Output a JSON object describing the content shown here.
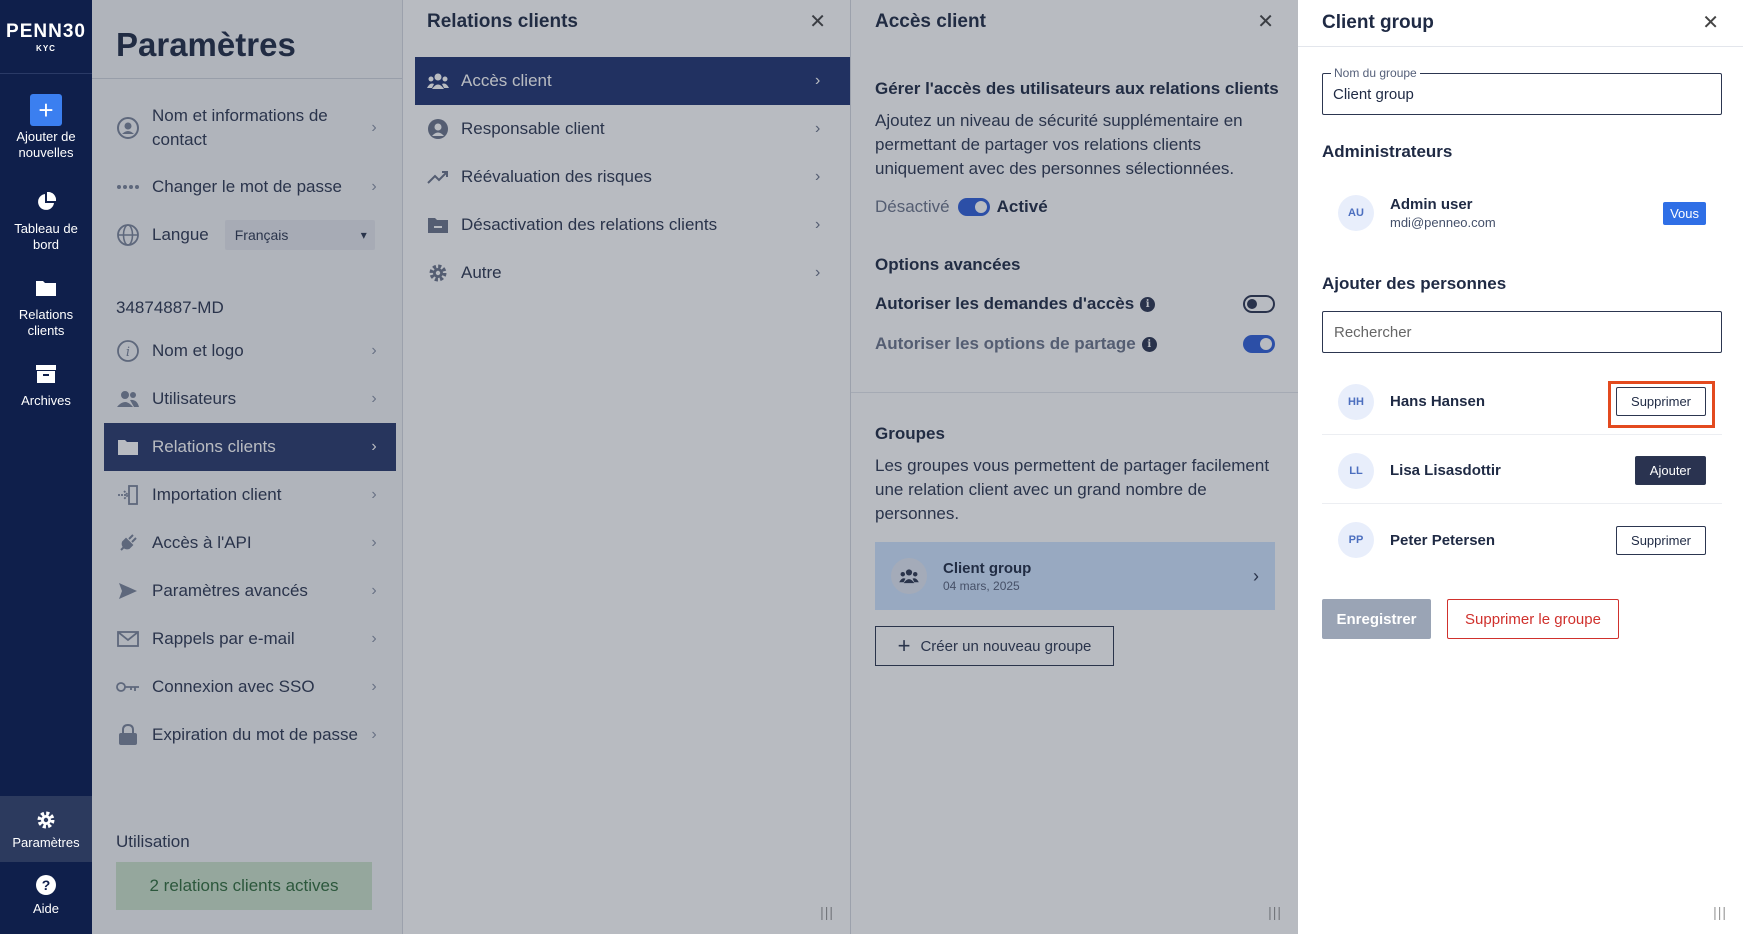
{
  "nav": {
    "logo": "PENN30",
    "logo_sub": "KYC",
    "add_new": "Ajouter de nouvelles",
    "dashboard": "Tableau de bord",
    "relations": "Relations clients",
    "archives": "Archives",
    "settings": "Paramètres",
    "help": "Aide"
  },
  "settings": {
    "title": "Paramètres",
    "items": [
      {
        "label": "Nom et informations de contact",
        "icon": "user-circle-icon"
      },
      {
        "label": "Changer le mot de passe",
        "icon": "password-dots-icon"
      },
      {
        "label": "Langue",
        "icon": "globe-icon",
        "value": "Français"
      }
    ],
    "company_id": "34874887-MD",
    "company_items": [
      {
        "label": "Nom et logo",
        "icon": "info-icon"
      },
      {
        "label": "Utilisateurs",
        "icon": "users-icon"
      },
      {
        "label": "Relations clients",
        "icon": "folder-icon"
      },
      {
        "label": "Importation client",
        "icon": "import-icon"
      },
      {
        "label": "Accès à l'API",
        "icon": "plug-icon"
      },
      {
        "label": "Paramètres avancés",
        "icon": "send-icon"
      },
      {
        "label": "Rappels par e-mail",
        "icon": "envelope-icon"
      },
      {
        "label": "Connexion avec SSO",
        "icon": "key-icon"
      },
      {
        "label": "Expiration du mot de passe",
        "icon": "lock-icon"
      }
    ],
    "usage_label": "Utilisation",
    "usage_value": "2 relations clients actives"
  },
  "relations_panel": {
    "title": "Relations clients",
    "items": [
      {
        "label": "Accès client",
        "icon": "group-icon"
      },
      {
        "label": "Responsable client",
        "icon": "user-circle-icon"
      },
      {
        "label": "Réévaluation des risques",
        "icon": "trend-icon"
      },
      {
        "label": "Désactivation des relations clients",
        "icon": "folder-minus-icon"
      },
      {
        "label": "Autre",
        "icon": "gear-icon"
      }
    ]
  },
  "access_panel": {
    "title": "Accès client",
    "heading": "Gérer l'accès des utilisateurs aux relations clients",
    "description": "Ajoutez un niveau de sécurité supplémentaire en permettant de partager vos relations clients uniquement avec des personnes sélectionnées.",
    "toggle_off_label": "Désactivé",
    "toggle_on_label": "Activé",
    "advanced_title": "Options avancées",
    "allow_requests": "Autoriser les demandes d'accès",
    "allow_sharing": "Autoriser les options de partage",
    "groups_title": "Groupes",
    "groups_desc": "Les groupes vous permettent de partager facilement une relation client avec un grand nombre de personnes.",
    "group_name": "Client group",
    "group_date": "04 mars, 2025",
    "create_group": "Créer un nouveau groupe"
  },
  "drawer": {
    "title": "Client group",
    "group_name_label": "Nom du groupe",
    "group_name_value": "Client group",
    "admins_title": "Administrateurs",
    "admin": {
      "initials": "AU",
      "name": "Admin user",
      "email": "mdi@penneo.com",
      "badge": "Vous"
    },
    "add_people_title": "Ajouter des personnes",
    "search_placeholder": "Rechercher",
    "people": [
      {
        "initials": "HH",
        "name": "Hans Hansen",
        "action": "Supprimer"
      },
      {
        "initials": "LL",
        "name": "Lisa Lisasdottir",
        "action": "Ajouter"
      },
      {
        "initials": "PP",
        "name": "Peter Petersen",
        "action": "Supprimer"
      }
    ],
    "save": "Enregistrer",
    "delete_group": "Supprimer le groupe"
  }
}
